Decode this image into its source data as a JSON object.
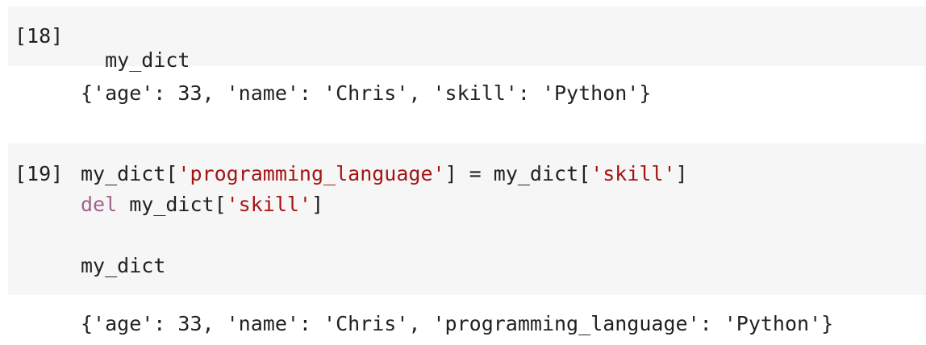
{
  "cells": [
    {
      "execution_count": "[18]",
      "code_lines": [
        {
          "tokens": [
            {
              "type": "name",
              "text": "my_dict"
            }
          ]
        }
      ],
      "output": "{'age': 33, 'name': 'Chris', 'skill': 'Python'}"
    },
    {
      "execution_count": "[19]",
      "code_lines": [
        {
          "tokens": [
            {
              "type": "name",
              "text": "my_dict["
            },
            {
              "type": "str",
              "text": "'programming_language'"
            },
            {
              "type": "name",
              "text": "] = my_dict["
            },
            {
              "type": "str",
              "text": "'skill'"
            },
            {
              "type": "name",
              "text": "]"
            }
          ]
        },
        {
          "tokens": [
            {
              "type": "kw",
              "text": "del"
            },
            {
              "type": "name",
              "text": " my_dict["
            },
            {
              "type": "str",
              "text": "'skill'"
            },
            {
              "type": "name",
              "text": "]"
            }
          ]
        },
        {
          "tokens": []
        },
        {
          "tokens": [
            {
              "type": "name",
              "text": "my_dict"
            }
          ]
        }
      ],
      "output": "{'age': 33, 'name': 'Chris', 'programming_language': 'Python'}"
    }
  ],
  "colors": {
    "cell_background": "#f6f6f6",
    "string": "#a31515",
    "keyword": "#a0648c",
    "text": "#212121"
  }
}
